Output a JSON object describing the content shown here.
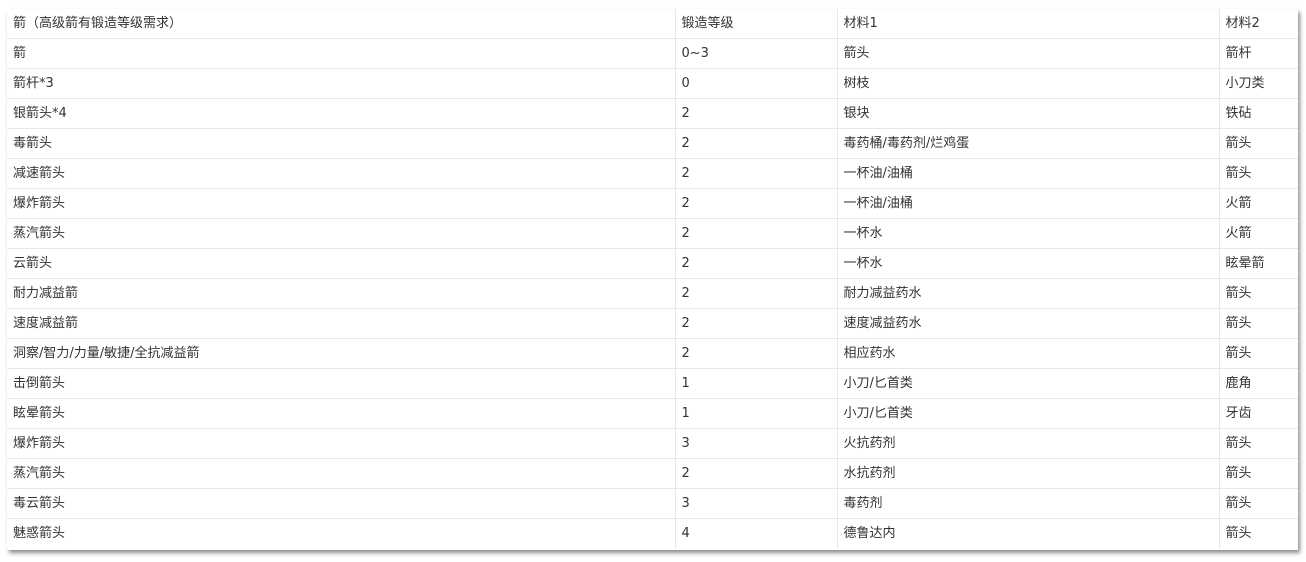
{
  "table": {
    "header": [
      "箭（高级箭有锻造等级需求）",
      "锻造等级",
      "材料1",
      "材料2"
    ],
    "rows": [
      [
        "箭",
        "0~3",
        "箭头",
        "箭杆"
      ],
      [
        "箭杆*3",
        "0",
        "树枝",
        "小刀类"
      ],
      [
        "银箭头*4",
        "2",
        "银块",
        "铁砧"
      ],
      [
        "毒箭头",
        "2",
        "毒药桶/毒药剂/烂鸡蛋",
        "箭头"
      ],
      [
        "减速箭头",
        "2",
        "一杯油/油桶",
        "箭头"
      ],
      [
        "爆炸箭头",
        "2",
        "一杯油/油桶",
        "火箭"
      ],
      [
        "蒸汽箭头",
        "2",
        "一杯水",
        "火箭"
      ],
      [
        "云箭头",
        "2",
        "一杯水",
        "眩晕箭"
      ],
      [
        "耐力减益箭",
        "2",
        "耐力减益药水",
        "箭头"
      ],
      [
        "速度减益箭",
        "2",
        "速度减益药水",
        "箭头"
      ],
      [
        "洞察/智力/力量/敏捷/全抗减益箭",
        "2",
        "相应药水",
        "箭头"
      ],
      [
        "击倒箭头",
        "1",
        "小刀/匕首类",
        "鹿角"
      ],
      [
        "眩晕箭头",
        "1",
        "小刀/匕首类",
        "牙齿"
      ],
      [
        "爆炸箭头",
        "3",
        "火抗药剂",
        "箭头"
      ],
      [
        "蒸汽箭头",
        "2",
        "水抗药剂",
        "箭头"
      ],
      [
        "毒云箭头",
        "3",
        "毒药剂",
        "箭头"
      ],
      [
        "魅惑箭头",
        "4",
        "德鲁达内",
        "箭头"
      ]
    ]
  }
}
